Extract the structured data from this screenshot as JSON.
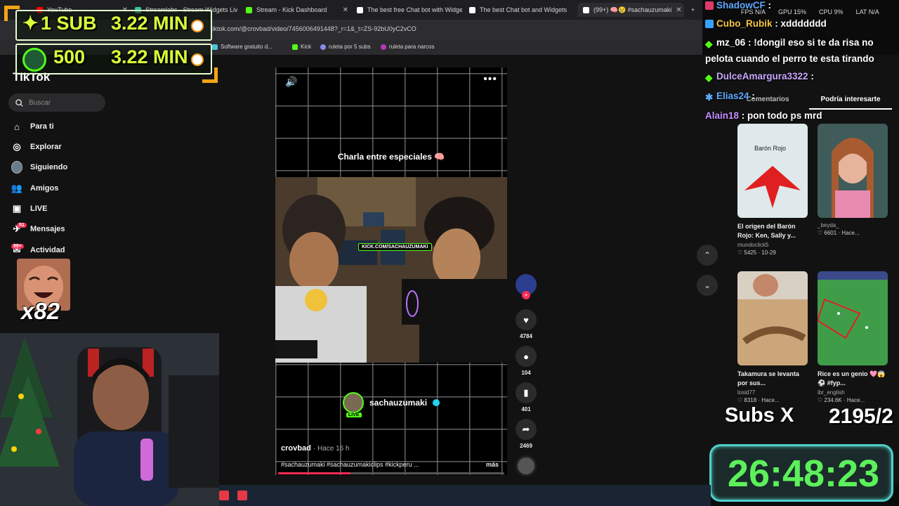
{
  "browser": {
    "tabs": [
      {
        "label": "YouTube",
        "color": "#ff0000"
      },
      {
        "label": "Streamlabs - Stream Widgets Live",
        "color": "#31c3a2"
      },
      {
        "label": "Stream - Kick Dashboard",
        "color": "#53fc18"
      },
      {
        "label": "The best free Chat bot with Widgets",
        "color": "#ffffff"
      },
      {
        "label": "The best Chat bot and Widgets",
        "color": "#ffffff"
      },
      {
        "label": "(99+) 🧠😢 #sachauzumaki",
        "color": "#ffffff"
      }
    ],
    "url": "tiktok.com/@crovbad/video/7456006491448?_r=1&_t=ZS-92bU0yC2vCO",
    "bookmarks": [
      "Software gratuito d...",
      "Kick",
      "ruleta por 5 subs",
      "ruleta para narcos"
    ]
  },
  "tiktok": {
    "logo": "TikTok",
    "search_placeholder": "Buscar",
    "nav": [
      {
        "label": "Para ti",
        "icon": "home-icon"
      },
      {
        "label": "Explorar",
        "icon": "compass-icon"
      },
      {
        "label": "Siguiendo",
        "icon": "avatar-icon"
      },
      {
        "label": "Amigos",
        "icon": "friends-icon"
      },
      {
        "label": "LIVE",
        "icon": "live-icon"
      },
      {
        "label": "Mensajes",
        "icon": "message-icon",
        "badge": "51"
      },
      {
        "label": "Actividad",
        "icon": "inbox-icon",
        "badge": "99+"
      }
    ],
    "video": {
      "title": "Charla entre especiales 🧠",
      "kick_tag": "KICK.COM/SACHAUZUMAKI",
      "streamer": "sachauzumaki",
      "live_label": "LIVE",
      "author": "crovbad",
      "time": "· Hace 16 h",
      "description": "#sachauzumaki #sachauzumakiclips #kickperu ...",
      "more": "más",
      "progress": 0.32
    },
    "actions": [
      {
        "name": "like-button",
        "icon": "♥",
        "count": "4784"
      },
      {
        "name": "comment-button",
        "icon": "●",
        "count": "104"
      },
      {
        "name": "save-button",
        "icon": "▮",
        "count": "401"
      },
      {
        "name": "share-button",
        "icon": "➦",
        "count": "2469"
      }
    ],
    "panel_tabs": [
      "Comentarios",
      "Podría interesarte"
    ],
    "cards": [
      {
        "title": "El origen del Barón Rojo: Ken, Sally y...",
        "author": "mundoclick5",
        "meta": "♡ 5425 · 10-29",
        "thumb_label": "Barón Rojo",
        "thumb_bg": "#dfe8ea"
      },
      {
        "title": "",
        "author": "_beyda_",
        "meta": "♡ 6601 · Hace...",
        "thumb_label": "",
        "thumb_bg": "#3f5c5a"
      },
      {
        "title": "Takamura se levanta por sus...",
        "author": "losid77",
        "meta": "♡ 8318 · Hace...",
        "thumb_label": "",
        "thumb_bg": "#b48a5f"
      },
      {
        "title": "Rice es un genio 🩷😱⚽ #fyp...",
        "author": "ibr_english",
        "meta": "♡ 234.6K · Hace...",
        "thumb_label": "",
        "thumb_bg": "#3f9d4a"
      }
    ]
  },
  "overlay": {
    "goal1": "1 SUB",
    "goal1_time": "3.22 MIN",
    "goal2": "500",
    "goal2_time": "3.22 MIN",
    "emote_count": "x82",
    "stats": [
      "FPS N/A",
      "GPU 15%",
      "CPU 9%",
      "LAT N/A"
    ],
    "chat": [
      {
        "user": "ShadowCF",
        "msg": ":",
        "color": "#5fa8ff"
      },
      {
        "user": "Cubo_Rubik",
        "msg": ": xddddddd",
        "color": "#f6c445"
      },
      {
        "user": "mz_06",
        "msg": ": !dongil eso si te da risa no",
        "color": "#ffffff"
      },
      {
        "user": "",
        "msg": "pelota cuando el perro te esta tirando",
        "color": "#ffffff"
      },
      {
        "user": "DulceAmargura3322",
        "msg": ":",
        "color": "#c8a6ff"
      },
      {
        "user": "Elias24",
        "msg": ":",
        "color": "#5fa8ff"
      },
      {
        "user": "Alain18",
        "msg": ": pon todo ps mrd",
        "color": "#c58cff"
      }
    ],
    "subs_label": "Subs X",
    "subs_count": "2195/2",
    "timer": "26:48:23"
  }
}
